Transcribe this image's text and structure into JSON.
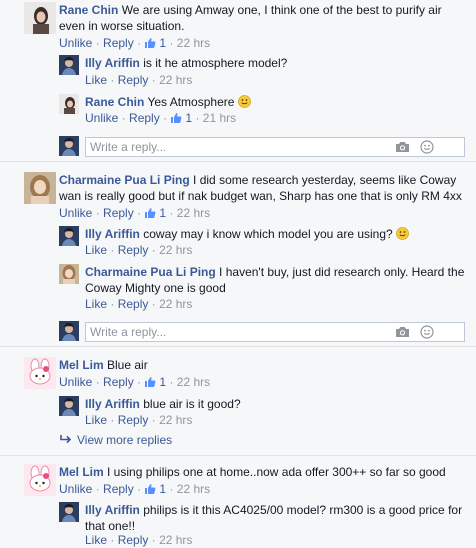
{
  "threads": [
    {
      "name": "Rane Chin",
      "text": "We are using Amway one, I think one of the best to purify air even in worse situation.",
      "unlike": "Unlike",
      "reply": "Reply",
      "likes": "1",
      "time": "22 hrs",
      "replies": [
        {
          "name": "Illy Ariffin",
          "text": "is it he atmosphere model?",
          "like": "Like",
          "reply": "Reply",
          "time": "22 hrs"
        },
        {
          "name": "Rane Chin",
          "text": "Yes Atmosphere",
          "unlike": "Unlike",
          "reply": "Reply",
          "likes": "1",
          "time": "21 hrs"
        }
      ],
      "reply_placeholder": "Write a reply..."
    },
    {
      "name": "Charmaine Pua Li Ping",
      "text": "I did some research yesterday, seems like Coway wan is really good but if nak budget wan, Sharp has one that is only RM 4xx",
      "unlike": "Unlike",
      "reply": "Reply",
      "likes": "1",
      "time": "22 hrs",
      "replies": [
        {
          "name": "Illy Ariffin",
          "text": "coway may i know which model you are using?",
          "like": "Like",
          "reply": "Reply",
          "time": "22 hrs"
        },
        {
          "name": "Charmaine Pua Li Ping",
          "text": "I haven't buy, just did research only. Heard the Coway Mighty one is good",
          "like": "Like",
          "reply": "Reply",
          "time": "22 hrs"
        }
      ],
      "reply_placeholder": "Write a reply..."
    },
    {
      "name": "Mel Lim",
      "text": "Blue air",
      "unlike": "Unlike",
      "reply": "Reply",
      "likes": "1",
      "time": "22 hrs",
      "replies": [
        {
          "name": "Illy Ariffin",
          "text": "blue air is it good?",
          "like": "Like",
          "reply": "Reply",
          "time": "22 hrs"
        }
      ],
      "view_more": "View more replies"
    },
    {
      "name": "Mel Lim",
      "text": "I using philips one at home..now ada offer 300++ so far so good",
      "unlike": "Unlike",
      "reply": "Reply",
      "likes": "1",
      "time": "22 hrs",
      "replies": [
        {
          "name": "Illy Ariffin",
          "text": "philips is it this AC4025/00 model? rm300 is a good price for that one!!",
          "like": "Like",
          "reply": "Reply",
          "time": "22 hrs"
        }
      ]
    }
  ],
  "separator": "·",
  "colors": {
    "link": "#3b5998",
    "muted": "#90949c",
    "background": "#f6f7f9",
    "divider": "#e1e2e3"
  },
  "icons": {
    "like": "thumbs-up-icon",
    "camera": "camera-icon",
    "emoji": "emoji-icon",
    "smile": "smile-emoji-icon",
    "view_more": "reply-arrow-icon"
  }
}
